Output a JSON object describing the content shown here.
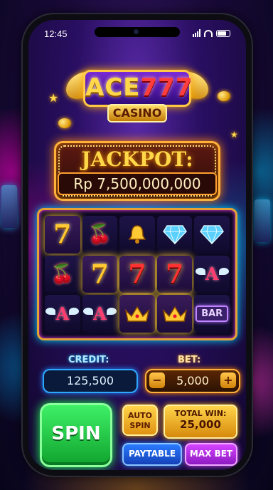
{
  "status_bar": {
    "time": "12:45"
  },
  "logo": {
    "brand_a": "ACE",
    "brand_b": "777",
    "sub": "CASINO"
  },
  "jackpot": {
    "title": "JACKPOT:",
    "amount": "Rp 7,500,000,000"
  },
  "reels": {
    "rows": [
      [
        "seven-gold",
        "cherry",
        "bell",
        "diamond",
        "diamond"
      ],
      [
        "cherry",
        "seven-gold",
        "seven-red",
        "seven-red",
        "winged-a"
      ],
      [
        "winged-a",
        "winged-a",
        "crown",
        "crown",
        "bar"
      ]
    ],
    "bar_label": "BAR",
    "seven_glyph": "7",
    "cherry_glyph": "🍒",
    "a_glyph": "A"
  },
  "credit": {
    "label": "CREDIT:",
    "value": "125,500"
  },
  "bet": {
    "label": "BET:",
    "value": "5,000",
    "minus": "−",
    "plus": "+"
  },
  "buttons": {
    "spin": "SPIN",
    "auto_line1": "AUTO",
    "auto_line2": "SPIN",
    "total_win_label": "TOTAL WIN:",
    "total_win_value": "25,000",
    "paytable": "PAYTABLE",
    "max_bet": "MAX BET"
  },
  "colors": {
    "gold": "#ffc933",
    "spin_green": "#22ff55",
    "paytable_blue": "#2a7bff",
    "maxbet_purple": "#d543ff"
  }
}
